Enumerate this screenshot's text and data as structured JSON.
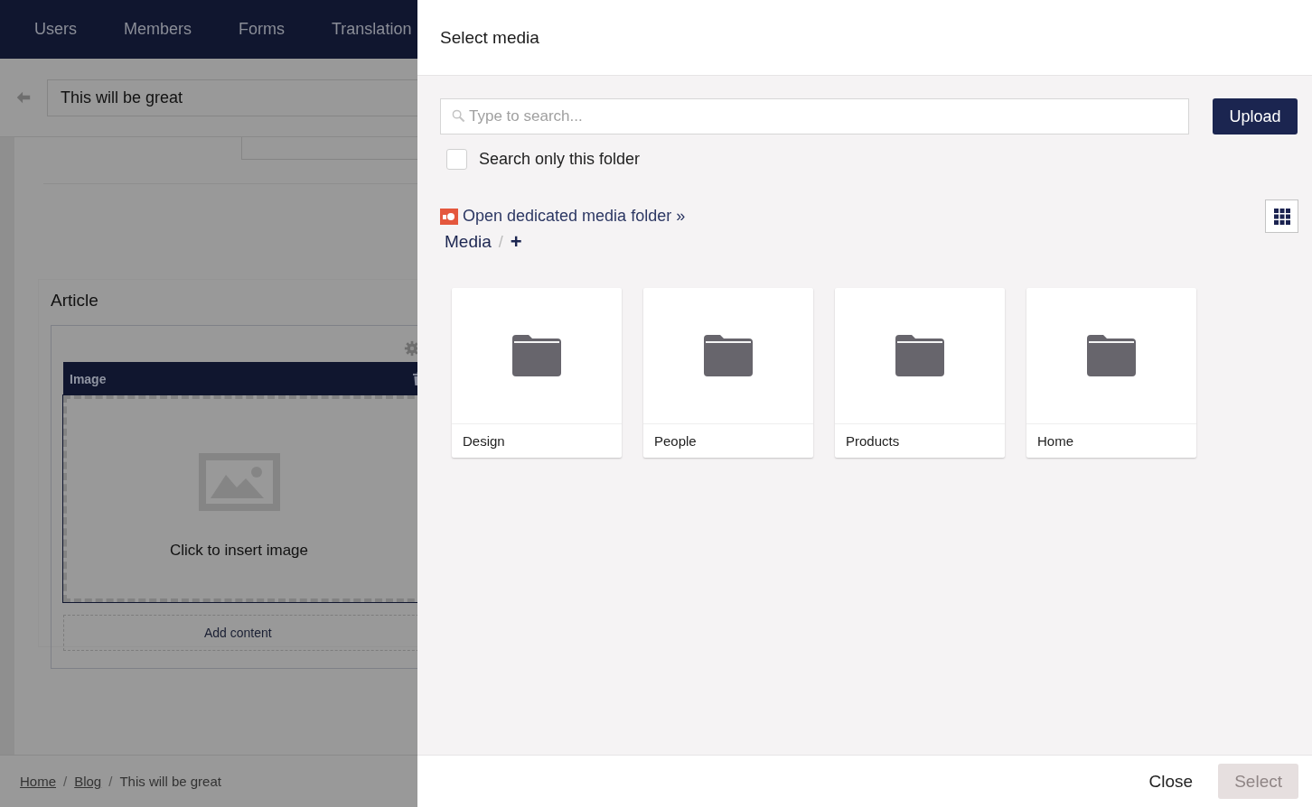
{
  "background": {
    "nav": [
      {
        "label": "Users"
      },
      {
        "label": "Members"
      },
      {
        "label": "Forms"
      },
      {
        "label": "Translation"
      }
    ],
    "title_field": {
      "value": "This will be great"
    },
    "section": {
      "title": "Article",
      "block": {
        "title": "Image",
        "hint": "Click to insert image"
      },
      "add_content": "Add content"
    },
    "breadcrumb": [
      {
        "label": "Home",
        "link": true
      },
      {
        "label": "Blog",
        "link": true
      },
      {
        "label": "This will be great",
        "link": false
      }
    ],
    "separator": "/"
  },
  "dialog": {
    "title": "Select media",
    "search": {
      "placeholder": "Type to search..."
    },
    "upload": "Upload",
    "search_only_folder": {
      "label": "Search only this folder",
      "checked": false
    },
    "media_folder_link": "Open dedicated media folder »",
    "path": [
      {
        "label": "Media"
      }
    ],
    "separator": "/",
    "add": "+",
    "folders": [
      {
        "name": "Design"
      },
      {
        "name": "People"
      },
      {
        "name": "Products"
      },
      {
        "name": "Home"
      }
    ],
    "buttons": [
      {
        "label": "Close",
        "kind": "link",
        "disabled": false
      },
      {
        "label": "Select",
        "kind": "primary",
        "disabled": true
      }
    ]
  }
}
